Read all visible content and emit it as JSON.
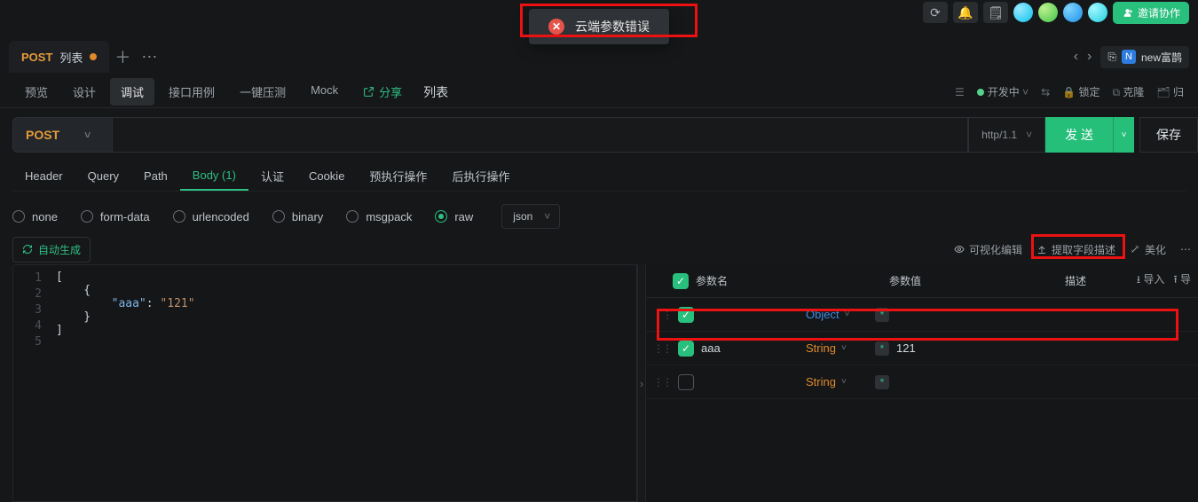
{
  "top": {
    "invite_label": "邀请协作",
    "branch_badge": "N",
    "branch_label": "new富鹊"
  },
  "toast": {
    "message": "云端参数错误"
  },
  "file_tab": {
    "method": "POST",
    "title": "列表"
  },
  "subnav": {
    "items": [
      "预览",
      "设计",
      "调试",
      "接口用例",
      "一键压测",
      "Mock"
    ],
    "active_index": 2,
    "share": "分享",
    "page_title": "列表",
    "status_label": "开发中",
    "lock": "锁定",
    "clone": "克隆",
    "back": "归"
  },
  "request": {
    "method": "POST",
    "protocol": "http/1.1",
    "send": "发 送",
    "save": "保存"
  },
  "reqtabs": {
    "items": [
      "Header",
      "Query",
      "Path",
      "Body (1)",
      "认证",
      "Cookie",
      "预执行操作",
      "后执行操作"
    ],
    "active_index": 3
  },
  "body": {
    "types": [
      "none",
      "form-data",
      "urlencoded",
      "binary",
      "msgpack",
      "raw"
    ],
    "active_index": 5,
    "format": "json",
    "autogen": "自动生成",
    "tools": {
      "visual": "可视化编辑",
      "extract": "提取字段描述",
      "beautify": "美化"
    }
  },
  "editor": {
    "lines": [
      "[",
      "    {",
      "        \"aaa\": \"121\"",
      "    }",
      "]"
    ],
    "key": "\"aaa\"",
    "val": "\"121\""
  },
  "params": {
    "head": {
      "name": "参数名",
      "value": "参数值",
      "desc": "描述",
      "import": "导入",
      "export": "导"
    },
    "rows": [
      {
        "checked": true,
        "name": "",
        "type": "Object",
        "type_kind": "obj",
        "value": "",
        "required": true
      },
      {
        "checked": true,
        "name": "aaa",
        "type": "String",
        "type_kind": "str",
        "value": "121",
        "required": true
      },
      {
        "checked": false,
        "name": "",
        "type": "String",
        "type_kind": "str",
        "value": "",
        "required": true
      }
    ]
  }
}
